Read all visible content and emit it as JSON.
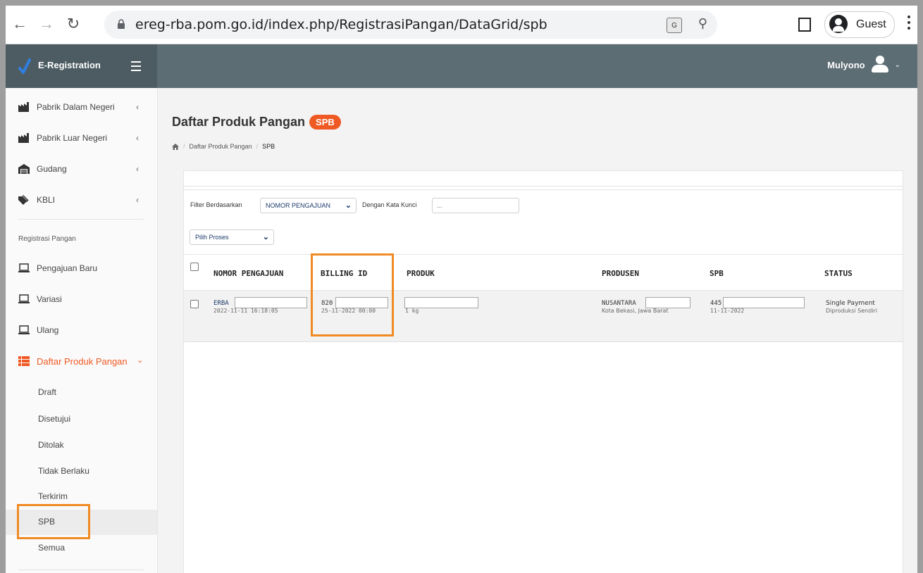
{
  "browser": {
    "url": "ereg-rba.pom.go.id/index.php/RegistrasiPangan/DataGrid/spb",
    "profile_label": "Guest"
  },
  "header": {
    "app_name": "E-Registration",
    "username": "Mulyono"
  },
  "sidebar": {
    "items": [
      {
        "label": "Pabrik Dalam Negeri",
        "icon": "factory-icon"
      },
      {
        "label": "Pabrik Luar Negeri",
        "icon": "factory-icon"
      },
      {
        "label": "Gudang",
        "icon": "warehouse-icon"
      },
      {
        "label": "KBLI",
        "icon": "tag-icon"
      }
    ],
    "section_title": "Registrasi Pangan",
    "reg_items": [
      {
        "label": "Pengajuan Baru",
        "icon": "laptop-icon"
      },
      {
        "label": "Variasi",
        "icon": "laptop-icon"
      },
      {
        "label": "Ulang",
        "icon": "laptop-icon"
      }
    ],
    "active_menu": {
      "label": "Daftar Produk Pangan",
      "icon": "list-icon"
    },
    "sub_items": [
      "Draft",
      "Disetujui",
      "Ditolak",
      "Tidak Berlaku",
      "Terkirim",
      "SPB",
      "Semua"
    ]
  },
  "page": {
    "title": "Daftar Produk Pangan",
    "badge": "SPB",
    "breadcrumb": [
      "Daftar Produk Pangan",
      "SPB"
    ]
  },
  "filter": {
    "label": "Filter Berdasarkan",
    "field_value": "NOMOR PENGAJUAN",
    "keyword_label": "Dengan Kata Kunci",
    "keyword_placeholder": "...",
    "process_value": "Pilih Proses"
  },
  "table": {
    "columns": [
      "NOMOR PENGAJUAN",
      "BILLING ID",
      "PRODUK",
      "PRODUSEN",
      "SPB",
      "STATUS"
    ],
    "rows": [
      {
        "nomor": "ERBA",
        "nomor_date": "2022-11-11 16:18:05",
        "billing": "820",
        "billing_date": "25-11-2022 00:00",
        "produk_sub": "1 kg",
        "produsen": "NUSANTARA",
        "produsen_sub": "Kota Bekasi, Jawa Barat",
        "spb": "445",
        "spb_date": "11-11-2022",
        "status": "Single Payment",
        "status_sub": "Diproduksi Sendiri"
      }
    ]
  },
  "colors": {
    "accent": "#ef5a24",
    "highlight_box": "#f08a24",
    "header_bg": "#5d6d74"
  }
}
